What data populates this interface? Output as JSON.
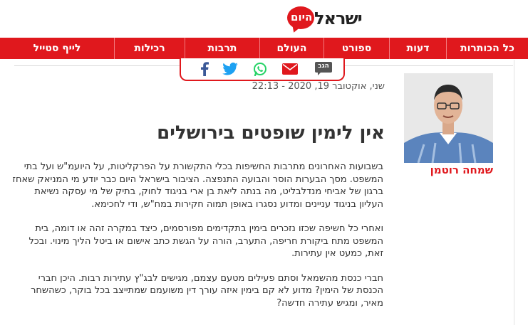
{
  "brand": {
    "logo_main": "ישראל",
    "logo_badge": "היום",
    "red": "#e0181d"
  },
  "nav": {
    "items": [
      {
        "label": "כל הכותרות",
        "key": "all-headlines"
      },
      {
        "label": "דעות",
        "key": "opinions"
      },
      {
        "label": "ספורט",
        "key": "sport"
      },
      {
        "label": "העולם",
        "key": "world"
      },
      {
        "label": "תרבות",
        "key": "culture"
      },
      {
        "label": "רכילות",
        "key": "gossip"
      },
      {
        "label": "לייף סטייל",
        "key": "lifestyle"
      }
    ]
  },
  "share": {
    "comment_label": "הגב",
    "icons": [
      "comment-icon",
      "email-icon",
      "whatsapp-icon",
      "twitter-icon",
      "facebook-icon"
    ]
  },
  "article": {
    "date": "שני, אוקטובר 19, 2020 - 22:13",
    "headline": "אין לימין שופטים בירושלים",
    "author": "שמחה רוטמן",
    "paragraphs": [
      "בשבועות האחרונים מתרבות החשיפות בכלי התקשורת על הפרקליטות, על היועמ\"ש ועל בתי המשפט. מסך הבערות הוסר והבועה התנפצה. הציבור בישראל היום כבר יודע מי המניאק שאחז ברגון של אביחי מנדלבליט, מה בנתה ליאת בן ארי בניגוד לחוק, בתיק של מי עסקה נשיאת העליון בניגוד עניינים ומדוע נסגרו באופן תמוה חקירות במח\"ש, ודי לחכימא.",
      "ואחרי כל חשיפה שכזו נזכרים בימין בתקדימים מפורסמים, כיצד במקרה זהה או דומה, בית המשפט מתח ביקורת חריפה, התערב, הורה על הגשת כתב אישום או ביטל הליך מינוי. ובכל זאת, כמעט אין עתירות.",
      "חברי כנסת מהשמאל וסתם פעילים מטעם עצמם, מגישים לבג\"ץ עתירות רבות. היכן חברי הכנסת של הימין? מדוע לא קם בימין איזה עורך דין משועמם שמתייצב בכל בוקר, כשהשחר מאיר, ומגיש עתירה חדשה?"
    ]
  }
}
